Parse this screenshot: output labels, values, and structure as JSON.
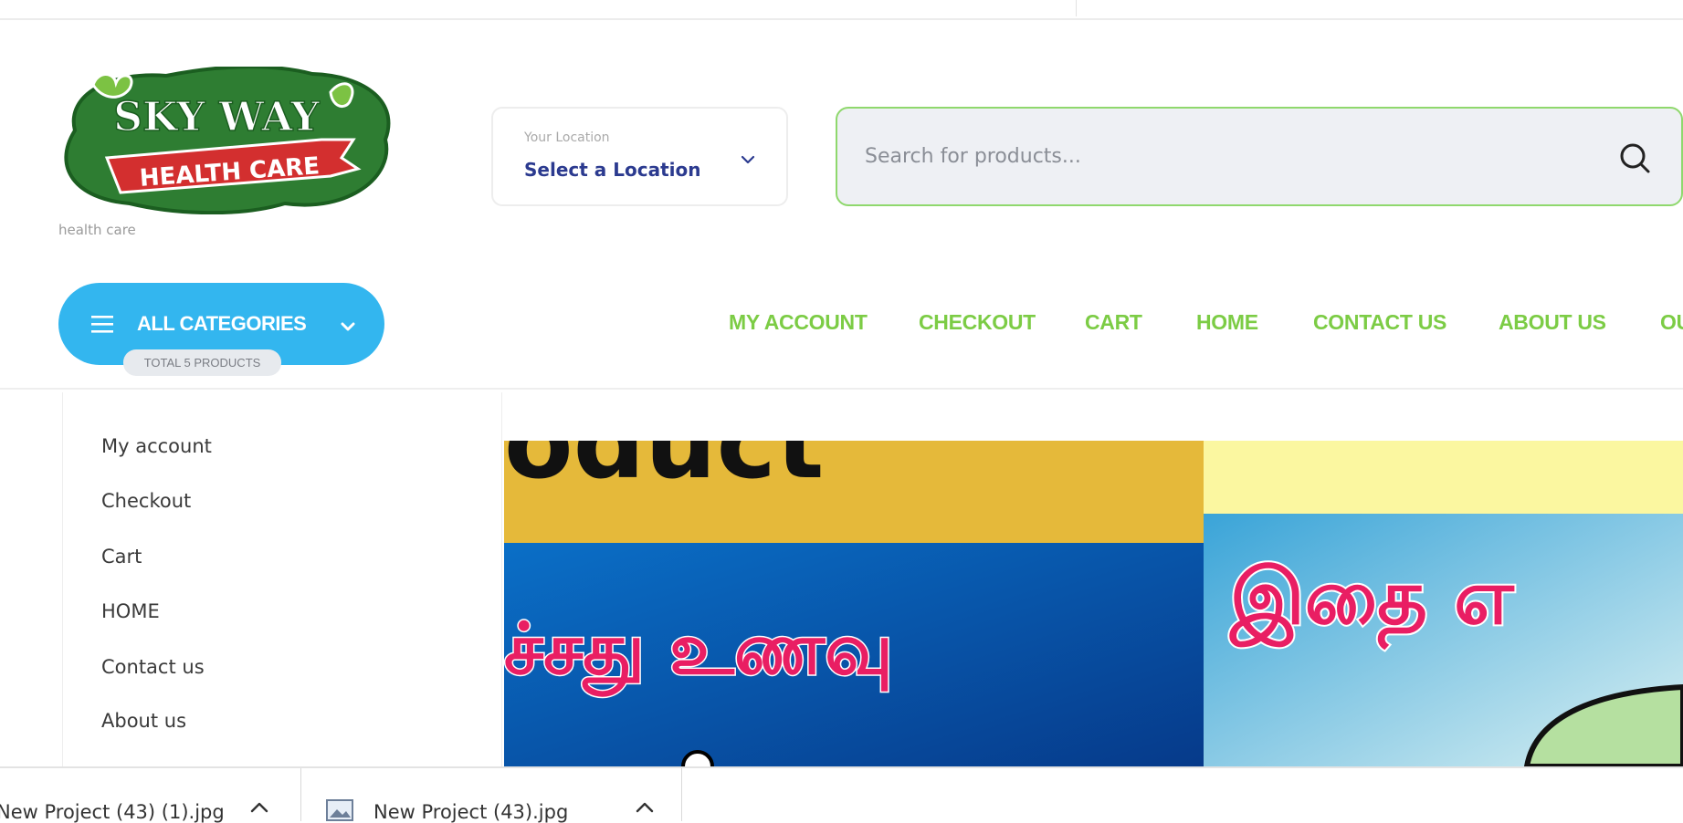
{
  "logo": {
    "line1": "SKY WAY",
    "line2": "HEALTH CARE"
  },
  "tagline": "health care",
  "location": {
    "label": "Your Location",
    "value": "Select a Location",
    "icon": "chevron-down-icon"
  },
  "search": {
    "placeholder": "Search for products...",
    "icon": "search-icon"
  },
  "all_categories": {
    "label": "ALL CATEGORIES",
    "badge": "TOTAL 5 PRODUCTS",
    "color": "#33b6ef"
  },
  "nav": {
    "color": "#7ccc45",
    "items": [
      "MY ACCOUNT",
      "CHECKOUT",
      "CART",
      "HOME",
      "CONTACT US",
      "ABOUT US",
      "OU"
    ]
  },
  "sidebar": {
    "items": [
      "My account",
      "Checkout",
      "Cart",
      "HOME",
      "Contact us",
      "About us"
    ]
  },
  "banner": {
    "left_top_text": "oduct",
    "left_tamil": "ச்சது உணவு",
    "right_tamil": "இதை எ"
  },
  "downloads": {
    "items": [
      {
        "name": "New Project (43) (1).jpg"
      },
      {
        "name": "New Project (43).jpg"
      }
    ]
  }
}
